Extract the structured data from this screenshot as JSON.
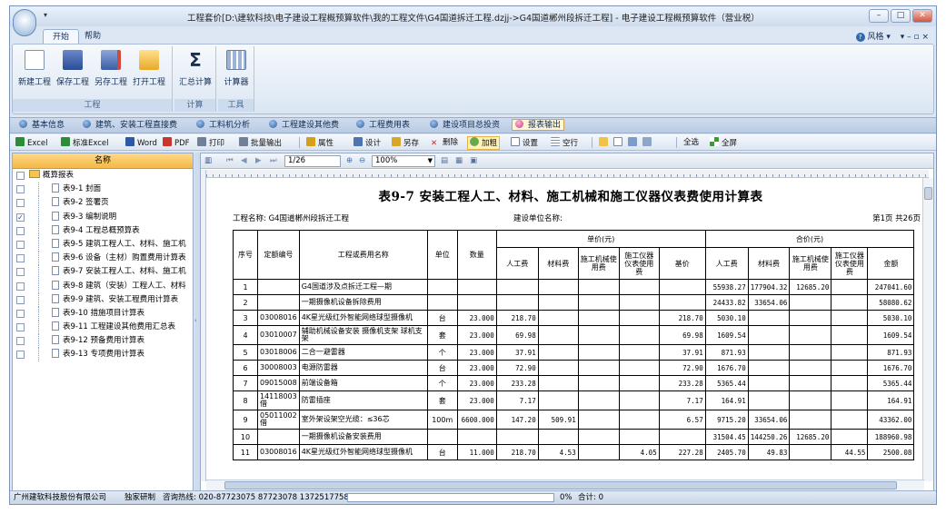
{
  "window": {
    "title": "工程套价[D:\\建软科技\\电子建设工程概预算软件\\我的工程文件\\G4国道拆迁工程.dzjj->G4国道郴州段拆迁工程] - 电子建设工程概预算软件（营业税）",
    "qat": "▾",
    "controls": [
      "–",
      "□",
      "✕"
    ]
  },
  "tabs": [
    {
      "label": "开始"
    },
    {
      "label": "帮助"
    }
  ],
  "help_area": {
    "style_label": "风格",
    "style_arrow": "▾",
    "help_icon": "?",
    "mini_controls": "▾ – ▫ ×"
  },
  "ribbon": {
    "groups": [
      {
        "label": "工程",
        "buttons": [
          "新建工程",
          "保存工程",
          "另存工程",
          "打开工程"
        ]
      },
      {
        "label": "计算",
        "buttons": [
          "汇总计算"
        ]
      },
      {
        "label": "工具",
        "buttons": [
          "计算器"
        ]
      }
    ]
  },
  "nav": [
    "基本信息",
    "建筑、安装工程直接费",
    "工料机分析",
    "工程建设其他费",
    "工程费用表",
    "建设项目总投资",
    "报表输出"
  ],
  "nav_selected": 6,
  "toolbar": [
    "Excel",
    "标准Excel",
    "Word",
    "PDF",
    "打印",
    "批量输出",
    "属性",
    "设计",
    "另存",
    "删除",
    "加粗",
    "设置",
    "空行",
    "全选",
    "全屏"
  ],
  "tree": {
    "header": "名称",
    "root": "概算报表",
    "items": [
      {
        "label": "表9-1 封面",
        "checked": false
      },
      {
        "label": "表9-2 签署页",
        "checked": false
      },
      {
        "label": "表9-3 编制说明",
        "checked": true
      },
      {
        "label": "表9-4 工程总概预算表",
        "checked": false
      },
      {
        "label": "表9-5 建筑工程人工、材料、施工机",
        "checked": false
      },
      {
        "label": "表9-6 设备（主材）购置费用计算表",
        "checked": false
      },
      {
        "label": "表9-7 安装工程人工、材料、施工机",
        "checked": false
      },
      {
        "label": "表9-8 建筑（安装）工程人工、材料",
        "checked": false
      },
      {
        "label": "表9-9 建筑、安装工程费用计算表",
        "checked": false
      },
      {
        "label": "表9-10 措施项目计算表",
        "checked": false
      },
      {
        "label": "表9-11 工程建设其他费用汇总表",
        "checked": false
      },
      {
        "label": "表9-12 预备费用计算表",
        "checked": false
      },
      {
        "label": "表9-13 专项费用计算表",
        "checked": false
      }
    ]
  },
  "preview": {
    "page_field": "1/26",
    "zoom": "100%"
  },
  "report": {
    "title": "表9-7  安装工程人工、材料、施工机械和施工仪器仪表费使用计算表",
    "project_label": "工程名称: G4国道郴州段拆迁工程",
    "unit_label": "建设单位名称:",
    "page_info": "第1页 共26页",
    "headers": {
      "seq": "序号",
      "code": "定额编号",
      "name": "工程或费用名称",
      "unit": "单位",
      "qty": "数量",
      "unit_price": "单价(元)",
      "total_price": "合价(元)",
      "labor": "人工费",
      "material": "材料费",
      "machine": "施工机械使用费",
      "instrument": "施工仪器仪表使用费",
      "base": "基价",
      "amount": "金额"
    },
    "rows": [
      [
        "1",
        "",
        "G4国道涉及点拆迁工程—期",
        "",
        "",
        "",
        "",
        "",
        "",
        "",
        "55938.27",
        "177904.32",
        "12685.20",
        "",
        "247041.60"
      ],
      [
        "2",
        "",
        "一期摄像机设备拆除费用",
        "",
        "",
        "",
        "",
        "",
        "",
        "",
        "24433.82",
        "33654.06",
        "",
        "",
        "58080.62"
      ],
      [
        "3",
        "03008016",
        "4K星光级红外智能网络球型摄像机",
        "台",
        "23.000",
        "218.70",
        "",
        "",
        "",
        "218.70",
        "5030.10",
        "",
        "",
        "",
        "5030.10"
      ],
      [
        "4",
        "03010007",
        "辅助机械设备安装 摄像机支架 球机支架",
        "套",
        "23.000",
        "69.98",
        "",
        "",
        "",
        "69.98",
        "1609.54",
        "",
        "",
        "",
        "1609.54"
      ],
      [
        "5",
        "03018006",
        "二合一避雷器",
        "个",
        "23.000",
        "37.91",
        "",
        "",
        "",
        "37.91",
        "871.93",
        "",
        "",
        "",
        "871.93"
      ],
      [
        "6",
        "30008003",
        "电源防雷器",
        "台",
        "23.000",
        "72.90",
        "",
        "",
        "",
        "72.90",
        "1676.70",
        "",
        "",
        "",
        "1676.70"
      ],
      [
        "7",
        "09015008",
        "前端设备箱",
        "个",
        "23.000",
        "233.28",
        "",
        "",
        "",
        "233.28",
        "5365.44",
        "",
        "",
        "",
        "5365.44"
      ],
      [
        "8",
        "14118003借",
        "防雷插座",
        "套",
        "23.000",
        "7.17",
        "",
        "",
        "",
        "7.17",
        "164.91",
        "",
        "",
        "",
        "164.91"
      ],
      [
        "9",
        "05011002借",
        "室外架设架空光缆：≤36芯",
        "100m",
        "6600.000",
        "147.20",
        "509.91",
        "",
        "",
        "6.57",
        "9715.20",
        "33654.06",
        "",
        "",
        "43362.00"
      ],
      [
        "10",
        "",
        "一期摄像机设备安装费用",
        "",
        "",
        "",
        "",
        "",
        "",
        "",
        "31504.45",
        "144250.26",
        "12685.20",
        "",
        "188960.98"
      ],
      [
        "11",
        "03008016",
        "4K星光级红外智能网络球型摄像机",
        "台",
        "11.000",
        "218.70",
        "4.53",
        "",
        "4.05",
        "227.28",
        "2405.70",
        "49.83",
        "",
        "44.55",
        "2500.08"
      ]
    ]
  },
  "status": {
    "company": "广州建软科技股份有限公司",
    "dev": "独家研制",
    "hotline": "咨询热线: 020-87723075 87723078  13725177580",
    "progress_text": "0%",
    "progress": 0,
    "total": "合计: 0"
  }
}
